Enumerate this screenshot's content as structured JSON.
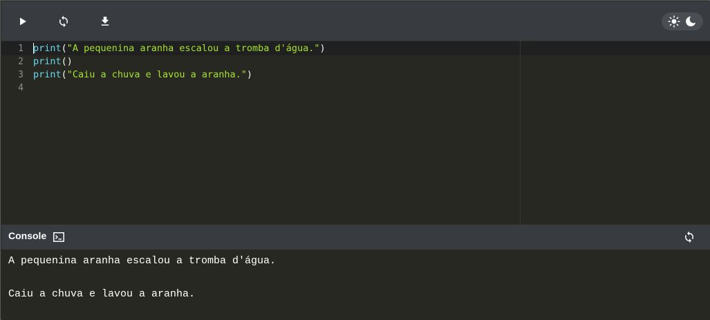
{
  "toolbar": {
    "run_icon": "play-icon",
    "reset_icon": "refresh-icon",
    "download_icon": "download-icon",
    "theme_icons": [
      "sun-icon",
      "moon-icon"
    ]
  },
  "editor": {
    "line_numbers": [
      "1",
      "2",
      "3",
      "4"
    ],
    "lines": [
      [
        {
          "t": "print",
          "c": "kw"
        },
        {
          "t": "(",
          "c": "pn"
        },
        {
          "t": "\"A pequenina aranha escalou a tromba d'água.\"",
          "c": "st"
        },
        {
          "t": ")",
          "c": "pn"
        }
      ],
      [
        {
          "t": "print",
          "c": "kw"
        },
        {
          "t": "()",
          "c": "pn"
        }
      ],
      [
        {
          "t": "print",
          "c": "kw"
        },
        {
          "t": "(",
          "c": "pn"
        },
        {
          "t": "\"Caiu a chuva e lavou a aranha.\"",
          "c": "st"
        },
        {
          "t": ")",
          "c": "pn"
        }
      ],
      []
    ]
  },
  "console": {
    "title": "Console",
    "output": [
      "A pequenina aranha escalou a tromba d'água.",
      "",
      "Caiu a chuva e lavou a aranha."
    ]
  },
  "colors": {
    "keyword": "#66d9ef",
    "string": "#a6e22e",
    "background": "#272822",
    "toolbar": "#383b40"
  }
}
